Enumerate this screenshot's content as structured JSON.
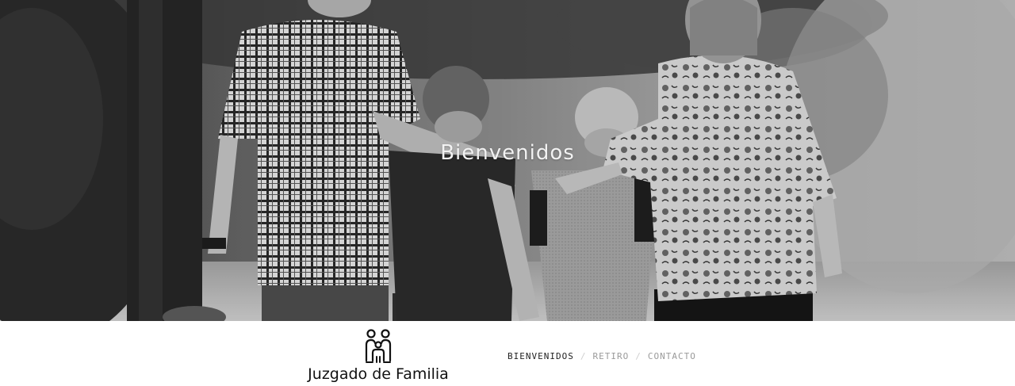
{
  "hero": {
    "title": "Bienvenidos"
  },
  "brand": {
    "icon": "family-icon",
    "name": "Juzgado de Familia"
  },
  "nav": {
    "items": [
      {
        "label": "BIENVENIDOS",
        "active": true
      },
      {
        "label": "RETIRO",
        "active": false
      },
      {
        "label": "CONTACTO",
        "active": false
      }
    ],
    "separator": "/"
  }
}
